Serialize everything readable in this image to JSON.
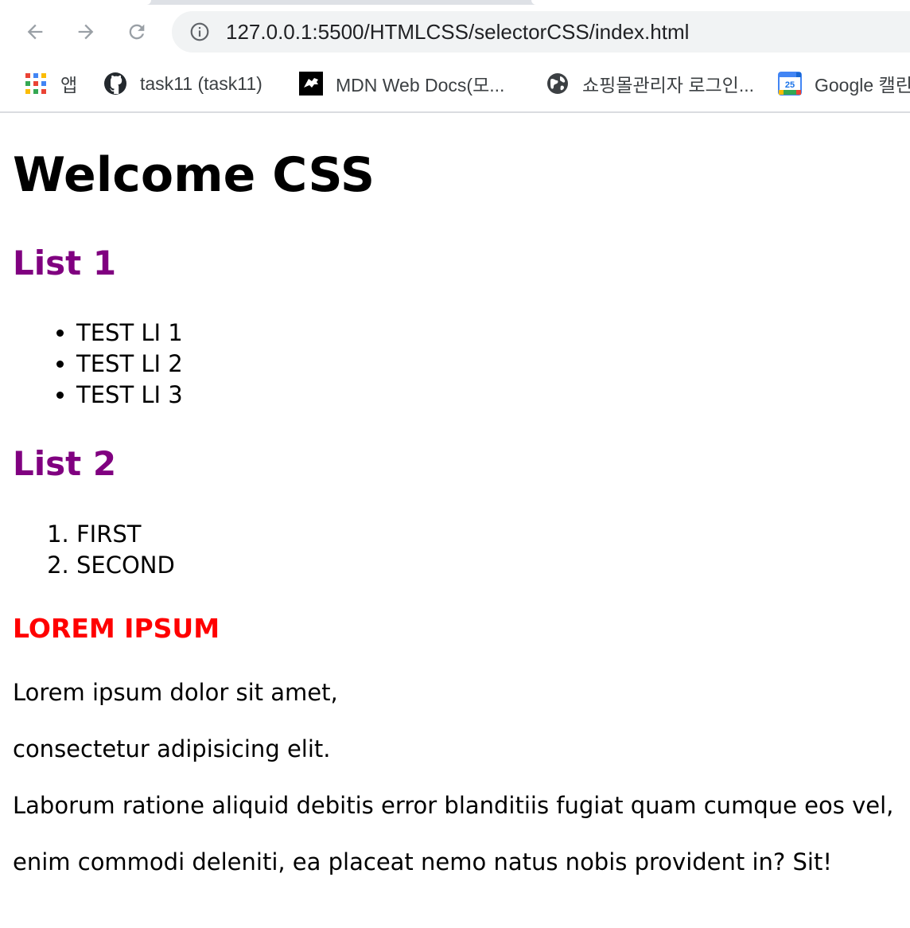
{
  "browser": {
    "url": "127.0.0.1:5500/HTMLCSS/selectorCSS/index.html",
    "icons": {
      "back": "arrow-left",
      "forward": "arrow-right",
      "reload": "circular-arrow",
      "site_info": "info-circle"
    },
    "bookmarks": [
      {
        "label": "앱",
        "icon": "apps-grid-icon"
      },
      {
        "label": "task11 (task11)",
        "icon": "github-icon"
      },
      {
        "label": "MDN Web Docs(모...",
        "icon": "mdn-icon"
      },
      {
        "label": "쇼핑몰관리자 로그인...",
        "icon": "globe-icon"
      },
      {
        "label": "Google 캘린",
        "icon": "google-calendar-icon"
      }
    ]
  },
  "page": {
    "title": "Welcome CSS",
    "list1": {
      "heading": "List 1",
      "items": [
        "TEST LI 1",
        "TEST LI 2",
        "TEST LI 3"
      ]
    },
    "list2": {
      "heading": "List 2",
      "items": [
        "FIRST",
        "SECOND"
      ]
    },
    "lorem": {
      "heading": "LOREM IPSUM",
      "paragraphs": [
        "Lorem ipsum dolor sit amet,",
        "consectetur adipisicing elit.",
        "Laborum ratione aliquid debitis error blanditiis fugiat quam cumque eos vel,",
        "enim commodi deleniti, ea placeat nemo natus nobis provident in? Sit!"
      ]
    }
  },
  "colors": {
    "list_heading": "#800080",
    "lorem_heading": "#ff0000",
    "omnibox_bg": "#f1f3f4"
  }
}
